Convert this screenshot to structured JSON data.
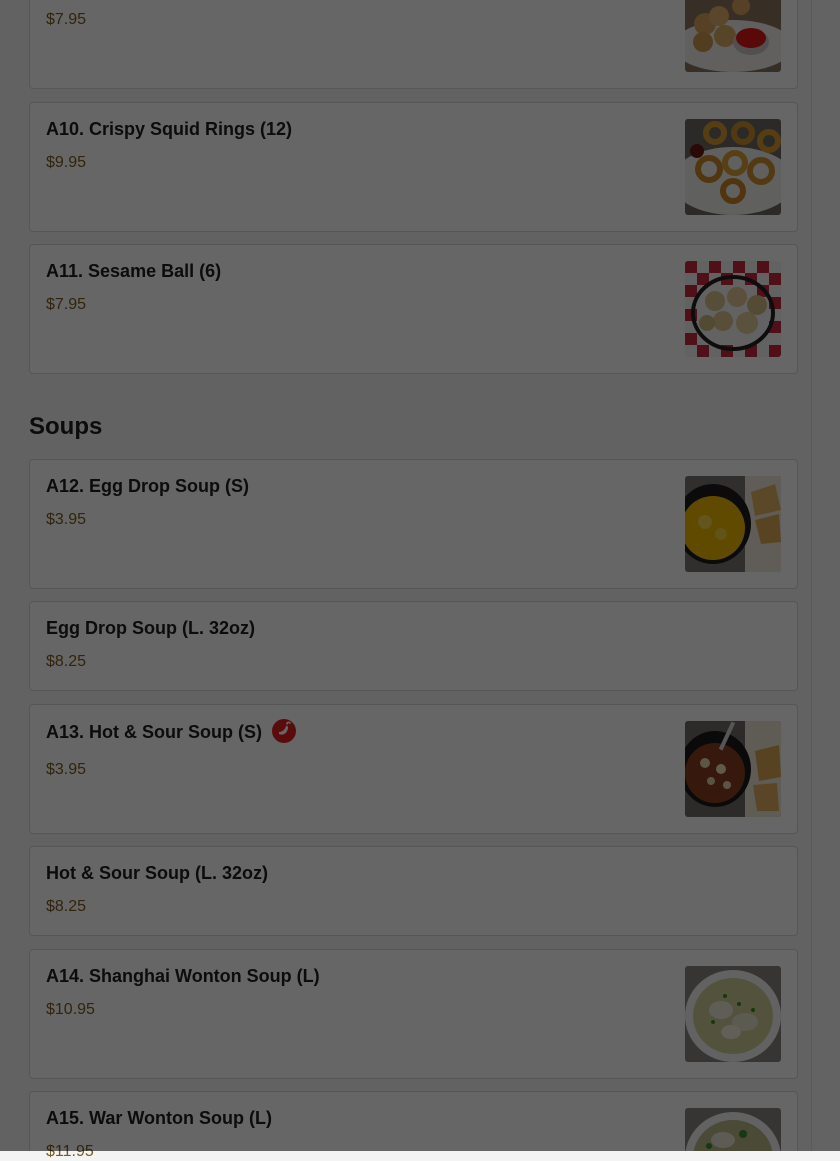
{
  "section": {
    "title": "Soups"
  },
  "items": [
    {
      "name": "",
      "price": "$7.95",
      "image": "fried-shrimp-photo"
    },
    {
      "name": "A10. Crispy Squid Rings (12)",
      "price": "$9.95",
      "image": "squid-rings-photo"
    },
    {
      "name": "A11. Sesame Ball (6)",
      "price": "$7.95",
      "image": "sesame-ball-photo"
    },
    {
      "name": "A12. Egg Drop Soup (S)",
      "price": "$3.95",
      "image": "egg-drop-soup-photo"
    },
    {
      "name": "Egg Drop Soup (L. 32oz)",
      "price": "$8.25"
    },
    {
      "name": "A13. Hot & Sour Soup (S)",
      "price": "$3.95",
      "image": "hot-sour-soup-photo",
      "badge": "spicy-pepper-icon"
    },
    {
      "name": "Hot & Sour Soup (L. 32oz)",
      "price": "$8.25"
    },
    {
      "name": "A14. Shanghai Wonton Soup (L)",
      "price": "$10.95",
      "image": "wonton-soup-photo"
    },
    {
      "name": "A15. War Wonton Soup (L)",
      "price": "$11.95",
      "image": "war-wonton-soup-photo"
    }
  ],
  "colors": {
    "price": "#7a5a1a",
    "spicy_badge": "#e02020",
    "overlay": "rgba(0,0,0,0.6)"
  }
}
